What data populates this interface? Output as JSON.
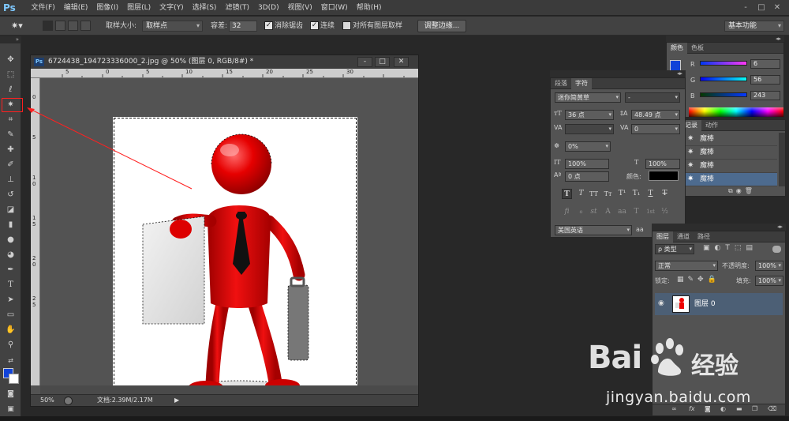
{
  "app": {
    "logo": "Ps",
    "accent": "#7ec8ff"
  },
  "menu": [
    "文件(F)",
    "编辑(E)",
    "图像(I)",
    "图层(L)",
    "文字(Y)",
    "选择(S)",
    "滤镜(T)",
    "3D(D)",
    "视图(V)",
    "窗口(W)",
    "帮助(H)"
  ],
  "window_controls": {
    "minimize": "-",
    "maximize": "□",
    "close": "✕"
  },
  "options_bar": {
    "sample_size_label": "取样大小:",
    "sample_size_value": "取样点",
    "tolerance_label": "容差:",
    "tolerance_value": "32",
    "antialias_label": "消除锯齿",
    "contiguous_label": "连续",
    "sample_all_label": "对所有图层取样",
    "refine_edge_label": "调整边缘...",
    "workspace": "基本功能"
  },
  "tools": [
    "move-icon",
    "marquee-icon",
    "lasso-icon",
    "magic-wand-icon",
    "crop-icon",
    "eyedropper-icon",
    "healing-icon",
    "brush-icon",
    "stamp-icon",
    "history-brush-icon",
    "eraser-icon",
    "gradient-icon",
    "blur-icon",
    "dodge-icon",
    "pen-icon",
    "type-icon",
    "path-select-icon",
    "shape-icon",
    "hand-icon",
    "zoom-icon"
  ],
  "colors": {
    "foreground": "#1143d8",
    "background": "#ffffff",
    "annotation": "#ff2020",
    "selected_row": "#4c5f75"
  },
  "document": {
    "title": "6724438_194723336000_2.jpg @ 50% (图层 0, RGB/8#) *",
    "zoom": "50%",
    "doc_size": "文档:2.39M/2.17M",
    "ruler_top": [
      "5",
      "0",
      "5",
      "10",
      "15",
      "20",
      "25",
      "30"
    ],
    "ruler_left": [
      "0",
      "5",
      "1\n0",
      "1\n5",
      "2\n0",
      "2\n5"
    ]
  },
  "color_panel": {
    "tabs": [
      "颜色",
      "色板"
    ],
    "r_label": "R",
    "r_value": "6",
    "g_label": "G",
    "g_value": "56",
    "b_label": "B",
    "b_value": "243"
  },
  "history_panel": {
    "tabs": [
      "记录",
      "动作"
    ],
    "items": [
      "魔棒",
      "魔棒",
      "魔棒",
      "魔棒"
    ]
  },
  "char_panel": {
    "tabs": [
      "段落",
      "字符"
    ],
    "font_family": "迷你简黄草",
    "font_style": "-",
    "font_size": "36 点",
    "leading": "48.49 点",
    "kerning": "",
    "tracking": "0",
    "scale_ratio": "0%",
    "vertical_scale": "100%",
    "horizontal_scale": "100%",
    "baseline_shift": "0 点",
    "color_label": "颜色:",
    "style_buttons": [
      "T",
      "T",
      "TT",
      "Tт",
      "T¹",
      "T₁",
      "T",
      "T"
    ],
    "opentype_buttons": [
      "fi",
      "ℴ",
      "st",
      "A",
      "aa",
      "T",
      "1st",
      "½"
    ],
    "language": "美国英语",
    "antialias": "aa"
  },
  "layers_panel": {
    "tabs": [
      "图层",
      "通道",
      "路径"
    ],
    "filter_label": "ρ 类型",
    "blend_mode": "正常",
    "opacity_label": "不透明度:",
    "opacity_value": "100%",
    "lock_label": "锁定:",
    "fill_label": "填充:",
    "fill_value": "100%",
    "layers": [
      {
        "name": "图层 0",
        "visible": true
      }
    ],
    "footer_icons": [
      "link-icon",
      "fx-icon",
      "mask-icon",
      "adjustment-icon",
      "group-icon",
      "new-layer-icon",
      "trash-icon"
    ]
  },
  "watermark": {
    "brand_left": "Bai",
    "brand_right": "经验",
    "url": "jingyan.baidu.com"
  }
}
